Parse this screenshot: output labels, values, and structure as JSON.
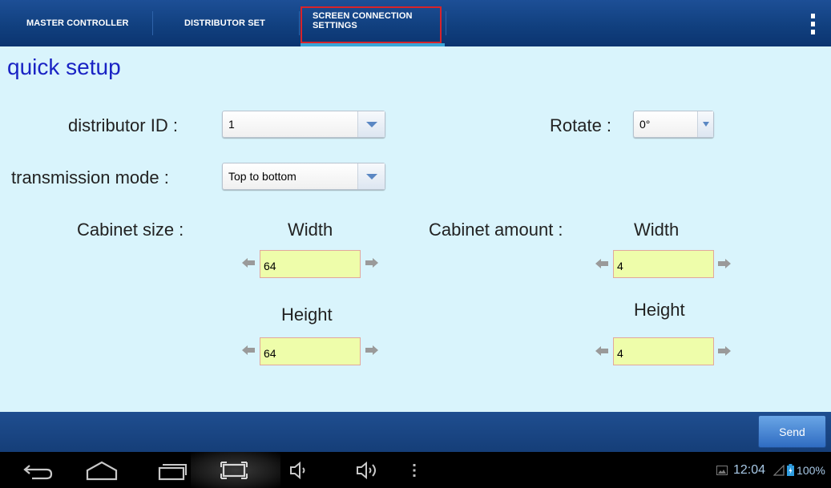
{
  "tabs": [
    {
      "label": "MASTER CONTROLLER"
    },
    {
      "label": "DISTRIBUTOR SET"
    },
    {
      "label_line1": "SCREEN CONNECTION",
      "label_line2": "SETTINGS",
      "selected": true
    }
  ],
  "overflow_menu_icon": "vertical-ellipsis-icon",
  "content": {
    "title": "quick setup",
    "distributor_id": {
      "label": "distributor ID :",
      "value": "1"
    },
    "rotate": {
      "label": "Rotate :",
      "value": "0°"
    },
    "transmission_mode": {
      "label": "transmission mode :",
      "value": "Top to bottom"
    },
    "cabinet_size": {
      "label": "Cabinet size :",
      "width_label": "Width",
      "width_value": "64",
      "height_label": "Height",
      "height_value": "64"
    },
    "cabinet_amount": {
      "label": "Cabinet amount :",
      "width_label": "Width",
      "width_value": "4",
      "height_label": "Height",
      "height_value": "4"
    }
  },
  "action_bar": {
    "send_label": "Send"
  },
  "system_bar": {
    "icons": [
      "back-icon",
      "home-icon",
      "recent-apps-icon",
      "screenshot-icon",
      "volume-down-icon",
      "volume-up-icon",
      "menu-icon"
    ],
    "time": "12:04",
    "battery": "100%"
  },
  "colors": {
    "tab_bar": "#11407f",
    "content_bg": "#d9f4fc",
    "title": "#1a23c4",
    "selected_tab_underline": "#3aa6d8",
    "highlight_box": "#d8232a",
    "number_field_bg": "#eefdaa",
    "send_button": "#2f6cc2"
  }
}
